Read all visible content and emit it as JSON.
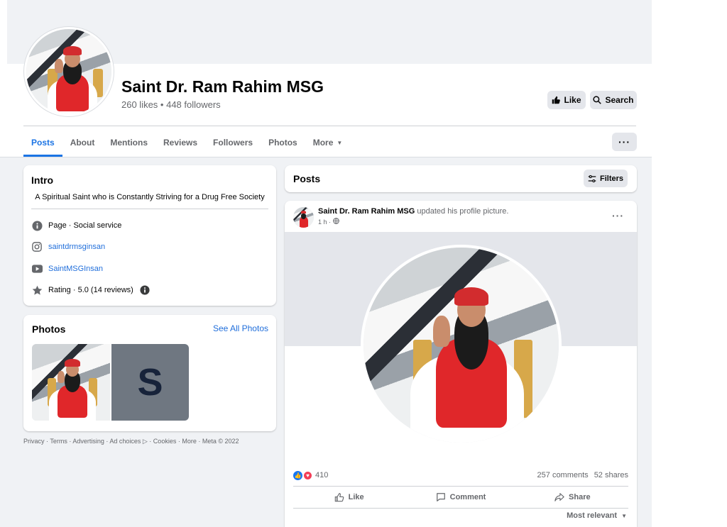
{
  "profile": {
    "name": "Saint Dr. Ram Rahim MSG",
    "stats": "260 likes • 448 followers",
    "like_label": "Like",
    "search_label": "Search",
    "more_options": "···"
  },
  "tabs": [
    {
      "label": "Posts",
      "active": true
    },
    {
      "label": "About"
    },
    {
      "label": "Mentions"
    },
    {
      "label": "Reviews"
    },
    {
      "label": "Followers"
    },
    {
      "label": "Photos"
    },
    {
      "label": "More"
    }
  ],
  "intro": {
    "title": "Intro",
    "bio": "A Spiritual Saint who is Constantly Striving for a Drug Free Society",
    "category": "Page · Social service",
    "instagram": "saintdrmsginsan",
    "youtube": "SaintMSGInsan",
    "rating": "Rating · 5.0 (14 reviews)"
  },
  "photos": {
    "title": "Photos",
    "see_all": "See All Photos",
    "thumb2_letter": "S"
  },
  "footer": "Privacy · Terms · Advertising · Ad choices ▷ · Cookies · More · Meta © 2022",
  "posts_header": {
    "title": "Posts",
    "filters_label": "Filters"
  },
  "post": {
    "author": "Saint Dr. Ram Rahim MSG",
    "action_text": "updated his profile picture.",
    "time": "1 h ·",
    "menu": "···",
    "reaction_count": "410",
    "comments": "257 comments",
    "shares": "52 shares",
    "like_label": "Like",
    "comment_label": "Comment",
    "share_label": "Share",
    "sort_label": "Most relevant"
  },
  "colors": {
    "accent": "#1b74e4",
    "link": "#216fdb",
    "page_bg": "#f0f2f5",
    "button_bg": "#e4e6eb"
  }
}
